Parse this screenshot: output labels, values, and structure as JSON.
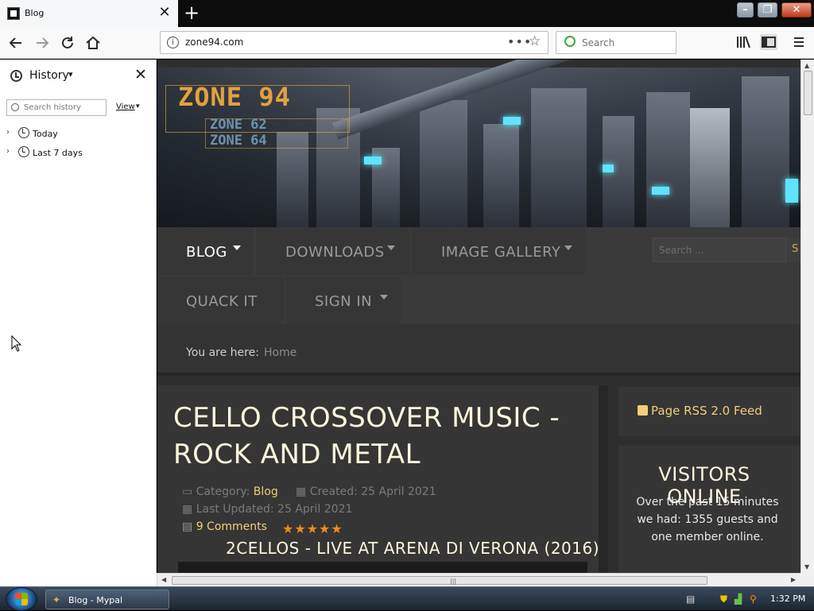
{
  "browser": {
    "tab_title": "Blog",
    "tab_close": "✕",
    "new_tab": "+",
    "url": "zone94.com",
    "url_dots": "•••",
    "search_placeholder": "Search"
  },
  "window_controls": {
    "minimize": "–",
    "maximize": "❐",
    "close": "✕"
  },
  "sidebar": {
    "title": "History",
    "search_placeholder": "Search history",
    "view_label": "View",
    "items": [
      {
        "label": "Today"
      },
      {
        "label": "Last 7 days"
      }
    ]
  },
  "site": {
    "logo_main": "ZONE 94",
    "logo_sub_1": "ZONE 62",
    "logo_sub_2": "ZONE 64",
    "menu": [
      {
        "label": "BLOG",
        "active": true
      },
      {
        "label": "DOWNLOADS"
      },
      {
        "label": "IMAGE GALLERY"
      },
      {
        "label": "QUACK IT"
      },
      {
        "label": "SIGN IN"
      }
    ],
    "search_placeholder": "Search ...",
    "search_button": "S",
    "breadcrumb_prefix": "You are here:",
    "breadcrumb_home": "Home",
    "article": {
      "title": "CELLO CROSSOVER MUSIC - ROCK AND METAL",
      "category_label": "Category:",
      "category_value": "Blog",
      "created": "Created: 25 April 2021",
      "updated": "Last Updated: 25 April 2021",
      "comments": "9 Comments",
      "rating_stars": "★★★★★",
      "video_title": "2CELLOS - LIVE AT ARENA DI VERONA (2016)"
    },
    "rss_label": "Page RSS 2.0 Feed",
    "visitors_heading": "VISITORS ONLINE",
    "visitors_text": "Over the past 15 minutes we had: 1355 guests and one member online."
  },
  "taskbar": {
    "task_label": "Blog - Mypal",
    "clock": "1:32 PM"
  },
  "colors": {
    "accent_gold": "#f0cf7a",
    "star_orange": "#f08a1e",
    "logo_orange": "#e3a040"
  }
}
